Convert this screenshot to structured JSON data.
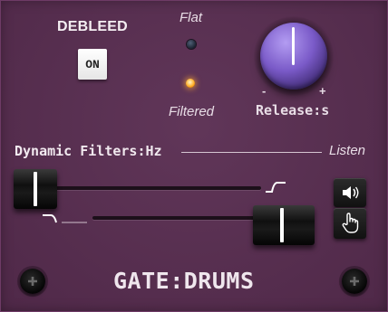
{
  "debleed": {
    "title": "DEBLEED",
    "toggle_label": "ON"
  },
  "mode": {
    "flat_label": "Flat",
    "filtered_label": "Filtered",
    "active": "Filtered",
    "led_active_color": "#ffb02a",
    "led_inactive_color": "#2a3446"
  },
  "release": {
    "label": "Release:s",
    "min_label": "-",
    "max_label": "+",
    "knob_color": "#7a5ac8"
  },
  "dynamic_filters": {
    "label": "Dynamic Filters:Hz",
    "listen_label": "Listen",
    "high_shape_icon": "high-cut-shape-icon",
    "low_shape_icon": "low-cut-shape-icon"
  },
  "listen_buttons": {
    "speaker_icon": "speaker-icon",
    "hand_icon": "hand-pointer-icon"
  },
  "footer": {
    "brand": "GATE:DRUMS",
    "screw_icon": "screw-icon"
  },
  "colors": {
    "panel": "#5a2e52",
    "text": "#f1e9ef"
  }
}
